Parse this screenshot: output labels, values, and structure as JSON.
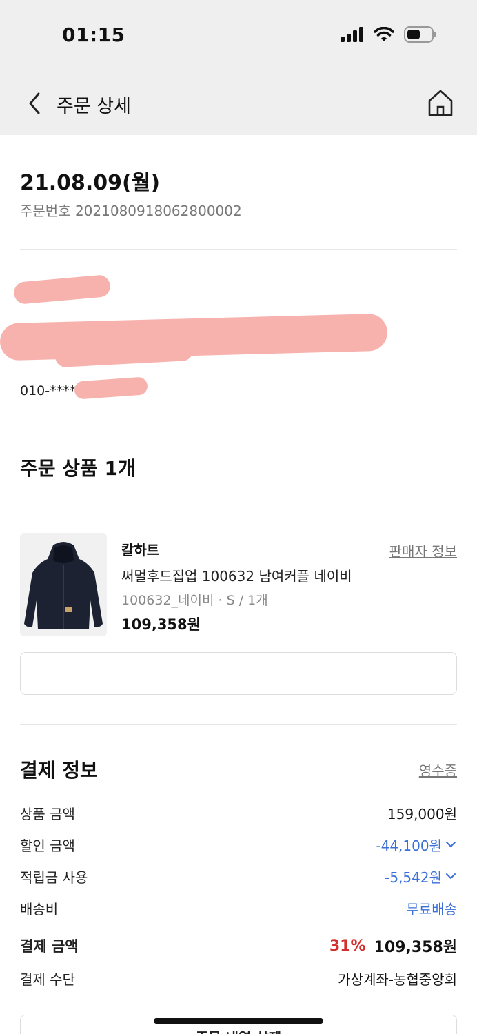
{
  "status": {
    "time": "01:15"
  },
  "nav": {
    "title": "주문 상세"
  },
  "order": {
    "date": "21.08.09(월)",
    "number": "주문번호 2021080918062800002"
  },
  "address": {
    "phone": "010-****"
  },
  "products": {
    "title": "주문 상품 1개",
    "items": [
      {
        "brand": "칼하트",
        "seller_link": "판매자 정보",
        "name": "써멀후드집업 100632 남여커플 네이비",
        "option": "100632_네이비 · S / 1개",
        "price": "109,358원"
      }
    ]
  },
  "payment": {
    "title": "결제 정보",
    "receipt_link": "영수증",
    "rows": [
      {
        "label": "상품 금액",
        "value": "159,000원"
      },
      {
        "label": "할인 금액",
        "value": "-44,100원"
      },
      {
        "label": "적립금 사용",
        "value": "-5,542원"
      },
      {
        "label": "배송비",
        "value": "무료배송"
      }
    ],
    "total": {
      "label": "결제 금액",
      "percent": "31%",
      "value": "109,358원"
    },
    "method": {
      "label": "결제 수단",
      "value": "가상계좌-농협중앙회"
    }
  },
  "footer": {
    "detail_button": "주문 내역 삭제"
  },
  "colors": {
    "accent_blue": "#3a6fd8",
    "discount_red": "#d32f2f",
    "redaction": "#f7b2ae"
  }
}
